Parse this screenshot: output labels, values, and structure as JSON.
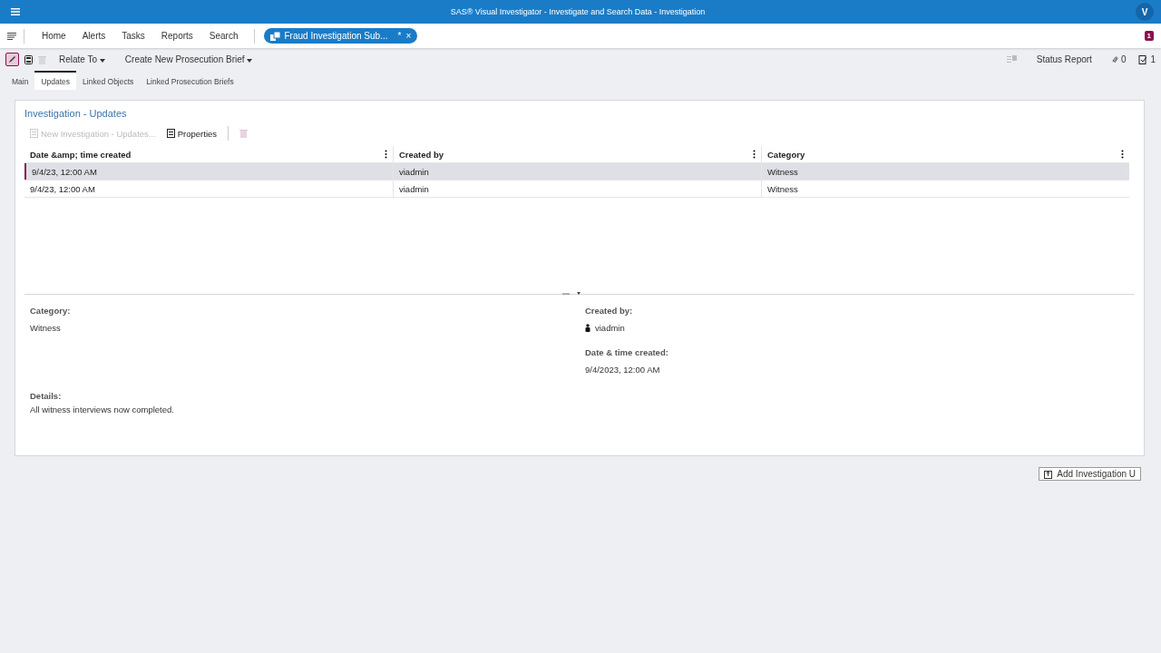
{
  "window": {
    "title": "SAS® Visual Investigator - Investigate and Search Data - Investigation",
    "avatar": "V"
  },
  "nav": {
    "items": [
      "Home",
      "Alerts",
      "Tasks",
      "Reports",
      "Search"
    ],
    "open_tab": {
      "label": "Fraud Investigation Sub...",
      "modified": "*",
      "close": "×"
    },
    "badge": "1"
  },
  "toolbar": {
    "edit_selected": true,
    "menus": [
      "Relate To",
      "Create New Prosecution Brief"
    ],
    "right": {
      "status_report": "Status Report",
      "attachments": "0",
      "tasks": "1"
    }
  },
  "tabs": [
    {
      "label": "Main",
      "selected": false
    },
    {
      "label": "Updates",
      "selected": true
    },
    {
      "label": "Linked Objects",
      "selected": false
    },
    {
      "label": "Linked Prosecution Briefs",
      "selected": false
    }
  ],
  "panel": {
    "title": "Investigation - Updates",
    "actions": [
      {
        "label": "New Investigation - Updates...",
        "disabled": true
      },
      {
        "label": "Properties",
        "disabled": false
      }
    ],
    "table": {
      "columns": [
        "Date &amp; time created",
        "Created by",
        "Category"
      ],
      "rows": [
        {
          "cells": [
            "9/4/23, 12:00 AM",
            "viadmin",
            "Witness"
          ],
          "selected": true
        },
        {
          "cells": [
            "9/4/23, 12:00 AM",
            "viadmin",
            "Witness"
          ],
          "selected": false
        }
      ]
    },
    "details": {
      "category_label": "Category:",
      "category": "Witness",
      "created_by_label": "Created by:",
      "created_by": "viadmin",
      "date_label": "Date & time created:",
      "date": "9/4/2023, 12:00 AM",
      "details_label": "Details:",
      "details": "All witness interviews now completed."
    }
  },
  "add_button": "Add Investigation U"
}
